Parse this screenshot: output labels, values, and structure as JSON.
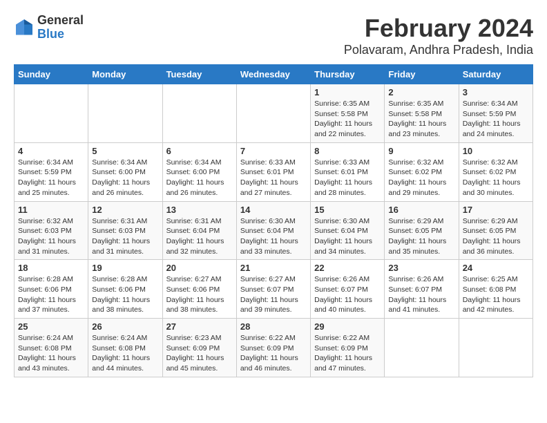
{
  "logo": {
    "line1": "General",
    "line2": "Blue"
  },
  "title": "February 2024",
  "subtitle": "Polavaram, Andhra Pradesh, India",
  "days_of_week": [
    "Sunday",
    "Monday",
    "Tuesday",
    "Wednesday",
    "Thursday",
    "Friday",
    "Saturday"
  ],
  "weeks": [
    [
      {
        "day": "",
        "info": ""
      },
      {
        "day": "",
        "info": ""
      },
      {
        "day": "",
        "info": ""
      },
      {
        "day": "",
        "info": ""
      },
      {
        "day": "1",
        "info": "Sunrise: 6:35 AM\nSunset: 5:58 PM\nDaylight: 11 hours and 22 minutes."
      },
      {
        "day": "2",
        "info": "Sunrise: 6:35 AM\nSunset: 5:58 PM\nDaylight: 11 hours and 23 minutes."
      },
      {
        "day": "3",
        "info": "Sunrise: 6:34 AM\nSunset: 5:59 PM\nDaylight: 11 hours and 24 minutes."
      }
    ],
    [
      {
        "day": "4",
        "info": "Sunrise: 6:34 AM\nSunset: 5:59 PM\nDaylight: 11 hours and 25 minutes."
      },
      {
        "day": "5",
        "info": "Sunrise: 6:34 AM\nSunset: 6:00 PM\nDaylight: 11 hours and 26 minutes."
      },
      {
        "day": "6",
        "info": "Sunrise: 6:34 AM\nSunset: 6:00 PM\nDaylight: 11 hours and 26 minutes."
      },
      {
        "day": "7",
        "info": "Sunrise: 6:33 AM\nSunset: 6:01 PM\nDaylight: 11 hours and 27 minutes."
      },
      {
        "day": "8",
        "info": "Sunrise: 6:33 AM\nSunset: 6:01 PM\nDaylight: 11 hours and 28 minutes."
      },
      {
        "day": "9",
        "info": "Sunrise: 6:32 AM\nSunset: 6:02 PM\nDaylight: 11 hours and 29 minutes."
      },
      {
        "day": "10",
        "info": "Sunrise: 6:32 AM\nSunset: 6:02 PM\nDaylight: 11 hours and 30 minutes."
      }
    ],
    [
      {
        "day": "11",
        "info": "Sunrise: 6:32 AM\nSunset: 6:03 PM\nDaylight: 11 hours and 31 minutes."
      },
      {
        "day": "12",
        "info": "Sunrise: 6:31 AM\nSunset: 6:03 PM\nDaylight: 11 hours and 31 minutes."
      },
      {
        "day": "13",
        "info": "Sunrise: 6:31 AM\nSunset: 6:04 PM\nDaylight: 11 hours and 32 minutes."
      },
      {
        "day": "14",
        "info": "Sunrise: 6:30 AM\nSunset: 6:04 PM\nDaylight: 11 hours and 33 minutes."
      },
      {
        "day": "15",
        "info": "Sunrise: 6:30 AM\nSunset: 6:04 PM\nDaylight: 11 hours and 34 minutes."
      },
      {
        "day": "16",
        "info": "Sunrise: 6:29 AM\nSunset: 6:05 PM\nDaylight: 11 hours and 35 minutes."
      },
      {
        "day": "17",
        "info": "Sunrise: 6:29 AM\nSunset: 6:05 PM\nDaylight: 11 hours and 36 minutes."
      }
    ],
    [
      {
        "day": "18",
        "info": "Sunrise: 6:28 AM\nSunset: 6:06 PM\nDaylight: 11 hours and 37 minutes."
      },
      {
        "day": "19",
        "info": "Sunrise: 6:28 AM\nSunset: 6:06 PM\nDaylight: 11 hours and 38 minutes."
      },
      {
        "day": "20",
        "info": "Sunrise: 6:27 AM\nSunset: 6:06 PM\nDaylight: 11 hours and 38 minutes."
      },
      {
        "day": "21",
        "info": "Sunrise: 6:27 AM\nSunset: 6:07 PM\nDaylight: 11 hours and 39 minutes."
      },
      {
        "day": "22",
        "info": "Sunrise: 6:26 AM\nSunset: 6:07 PM\nDaylight: 11 hours and 40 minutes."
      },
      {
        "day": "23",
        "info": "Sunrise: 6:26 AM\nSunset: 6:07 PM\nDaylight: 11 hours and 41 minutes."
      },
      {
        "day": "24",
        "info": "Sunrise: 6:25 AM\nSunset: 6:08 PM\nDaylight: 11 hours and 42 minutes."
      }
    ],
    [
      {
        "day": "25",
        "info": "Sunrise: 6:24 AM\nSunset: 6:08 PM\nDaylight: 11 hours and 43 minutes."
      },
      {
        "day": "26",
        "info": "Sunrise: 6:24 AM\nSunset: 6:08 PM\nDaylight: 11 hours and 44 minutes."
      },
      {
        "day": "27",
        "info": "Sunrise: 6:23 AM\nSunset: 6:09 PM\nDaylight: 11 hours and 45 minutes."
      },
      {
        "day": "28",
        "info": "Sunrise: 6:22 AM\nSunset: 6:09 PM\nDaylight: 11 hours and 46 minutes."
      },
      {
        "day": "29",
        "info": "Sunrise: 6:22 AM\nSunset: 6:09 PM\nDaylight: 11 hours and 47 minutes."
      },
      {
        "day": "",
        "info": ""
      },
      {
        "day": "",
        "info": ""
      }
    ]
  ]
}
